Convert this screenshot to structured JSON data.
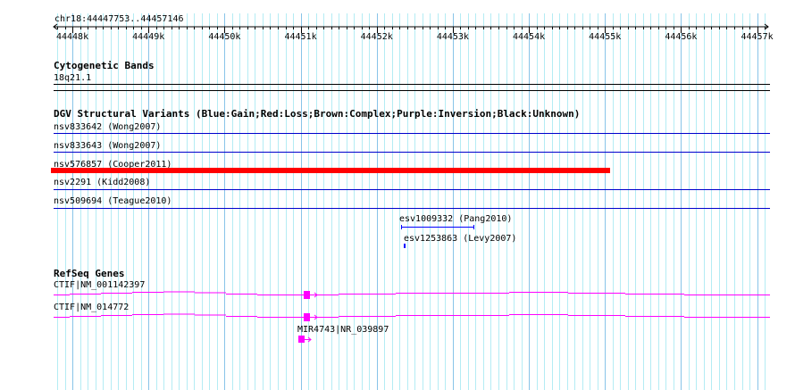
{
  "ruler": {
    "region": "chr18:44447753..44457146",
    "start": 44447753,
    "end": 44457146,
    "tick_labels": [
      "44448k",
      "44449k",
      "44450k",
      "44451k",
      "44452k",
      "44453k",
      "44454k",
      "44455k",
      "44456k",
      "44457k"
    ]
  },
  "cytoband": {
    "title": "Cytogenetic Bands",
    "band": "18q21.1"
  },
  "dgv": {
    "title": "DGV Structural Variants (Blue:Gain;Red:Loss;Brown:Complex;Purple:Inversion;Black:Unknown)",
    "variants": [
      {
        "label": "nsv833642 (Wong2007)",
        "color": "#0000cc"
      },
      {
        "label": "nsv833643 (Wong2007)",
        "color": "#0000cc"
      },
      {
        "label": "nsv576857 (Cooper2011)",
        "color": "#ff0000"
      },
      {
        "label": "nsv2291 (Kidd2008)",
        "color": "#0000cc"
      },
      {
        "label": "nsv509694 (Teague2010)",
        "color": "#0000cc"
      },
      {
        "label": "esv1009332 (Pang2010)",
        "color": "#0000ff"
      },
      {
        "label": "esv1253863 (Levy2007)",
        "color": "#0000ff"
      }
    ]
  },
  "refseq": {
    "title": "RefSeq Genes",
    "genes": [
      {
        "label": "CTIF|NM_001142397"
      },
      {
        "label": "CTIF|NM_014772"
      },
      {
        "label": "MIR4743|NR_039897"
      }
    ],
    "color": "#ff00ff"
  }
}
